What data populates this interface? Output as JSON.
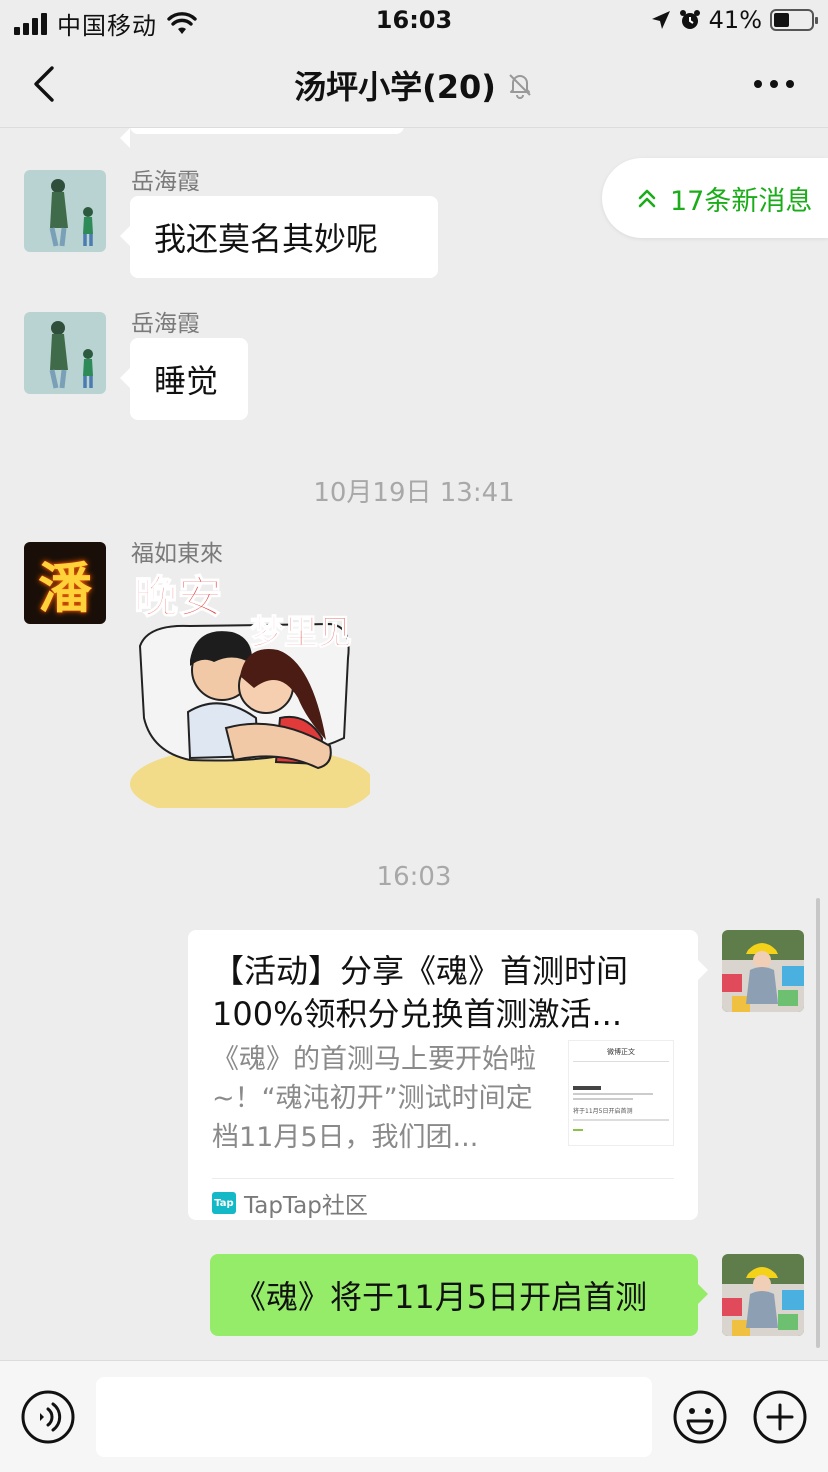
{
  "status_bar": {
    "carrier": "中国移动",
    "time": "16:03",
    "battery_percent_text": "41%",
    "battery_level": 0.41
  },
  "header": {
    "title": "汤坪小学(20)",
    "muted": true,
    "icons": {
      "back": "chevron-left-icon",
      "mute": "bell-off-icon",
      "more": "more-dots-icon"
    }
  },
  "new_messages": {
    "label": "17条新消息",
    "accent_color": "#1aad19"
  },
  "messages": [
    {
      "sender": "岳海霞",
      "text": "我还莫名其妙呢"
    },
    {
      "sender": "岳海霞",
      "text": "睡觉"
    },
    {
      "timestamp": "10月19日 13:41"
    },
    {
      "sender": "福如東來",
      "avatar_text": "潘",
      "sticker": {
        "line1": "晚安",
        "line2": "梦里见"
      }
    },
    {
      "timestamp": "16:03"
    },
    {
      "link_card": {
        "title": "【活动】分享《魂》首测时间100%领积分兑换首测激活...",
        "description": "《魂》的首测马上要开始啦~！“魂沌初开”测试时间定档11月5日，我们团...",
        "thumb_heading": "微博正文",
        "thumb_text": "将于11月5日开启首测",
        "source": "TapTap社区",
        "source_logo": "Tap"
      }
    },
    {
      "text": "《魂》将于11月5日开启首测"
    }
  ],
  "colors": {
    "background": "#ededed",
    "self_bubble": "#95ec69",
    "other_bubble": "#ffffff"
  },
  "input_bar": {
    "icons": {
      "voice": "voice-icon",
      "emoji": "emoji-icon",
      "plus": "plus-icon"
    }
  }
}
